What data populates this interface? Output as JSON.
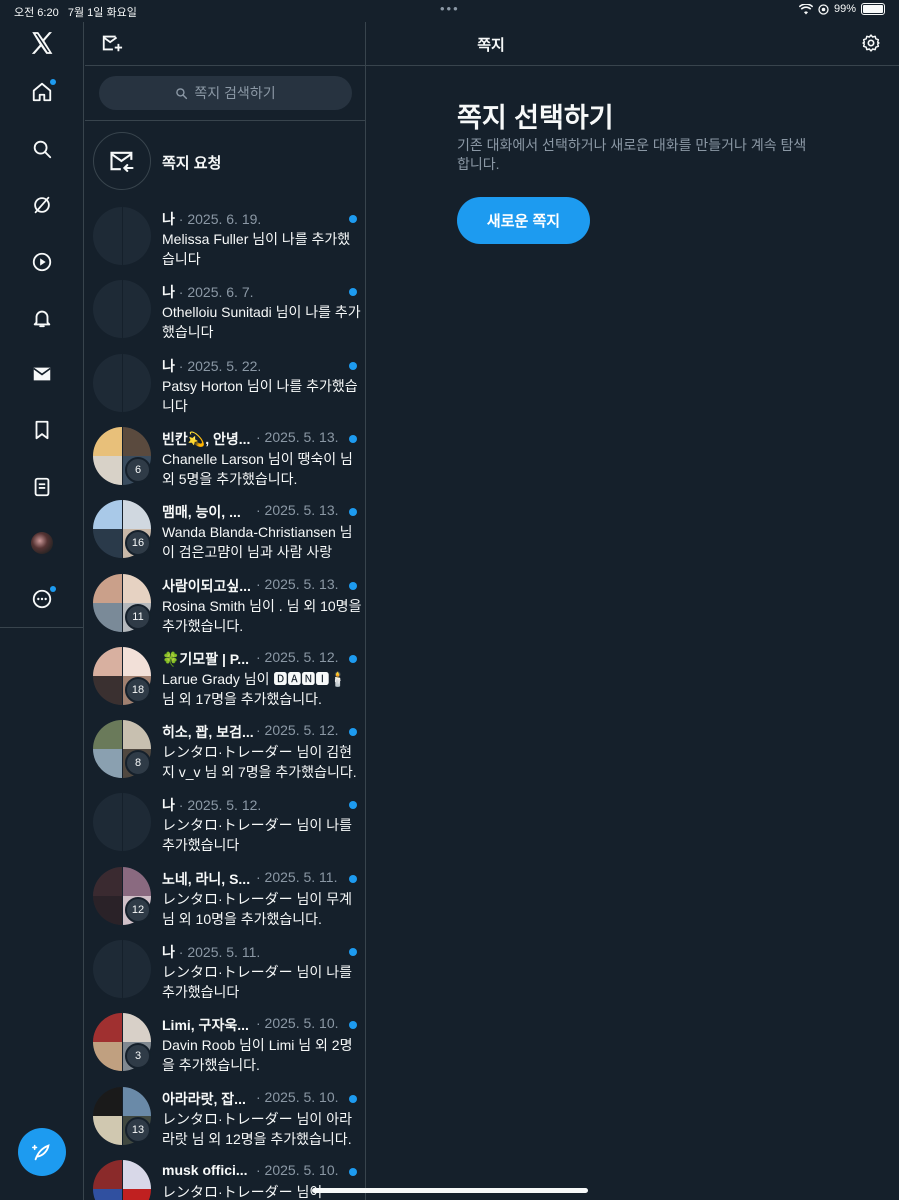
{
  "status_bar": {
    "time": "오전 6:20",
    "date": "7월 1일 화요일",
    "dots": "•••",
    "battery": "99%"
  },
  "nav": {
    "items": [
      {
        "name": "home",
        "icon": "home-icon",
        "dot": true
      },
      {
        "name": "explore",
        "icon": "search-icon",
        "dot": false
      },
      {
        "name": "grok",
        "icon": "grok-icon",
        "dot": false
      },
      {
        "name": "video",
        "icon": "play-icon",
        "dot": false
      },
      {
        "name": "notifications",
        "icon": "bell-icon",
        "dot": false
      },
      {
        "name": "messages",
        "icon": "envelope-icon",
        "dot": false
      },
      {
        "name": "bookmarks",
        "icon": "bookmark-icon",
        "dot": false
      },
      {
        "name": "lists",
        "icon": "list-icon",
        "dot": false
      },
      {
        "name": "profile",
        "icon": "avatar",
        "dot": false
      },
      {
        "name": "more",
        "icon": "more-icon",
        "dot": true
      }
    ]
  },
  "list": {
    "search_placeholder": "쪽지 검색하기",
    "requests_label": "쪽지 요청",
    "conversations": [
      {
        "name": "나",
        "date": "· 2025. 6. 19.",
        "body": "Melissa Fuller 님이 나를 추가했습니다",
        "count": "",
        "group": false
      },
      {
        "name": "나",
        "date": "· 2025. 6. 7.",
        "body": "Othelloiu Sunitadi 님이 나를 추가했습니다",
        "count": "",
        "group": false
      },
      {
        "name": "나",
        "date": "· 2025. 5. 22.",
        "body": "Patsy Horton 님이 나를 추가했습니다",
        "count": "",
        "group": false
      },
      {
        "name": "빈칸💫, 안녕...",
        "date": "· 2025. 5. 13.",
        "body": "Chanelle Larson 님이 땡숙이 님 외 5명을 추가했습니다.",
        "count": "6",
        "group": true
      },
      {
        "name": "맴매, 능이, ...",
        "date": "· 2025. 5. 13.",
        "body": "Wanda Blanda-Christiansen 님이 검은고먐이 님과 사람 사랑",
        "count": "16",
        "group": true
      },
      {
        "name": "사람이되고싶...",
        "date": "· 2025. 5. 13.",
        "body": "Rosina Smith 님이 . 님 외 10명을 추가했습니다.",
        "count": "11",
        "group": true
      },
      {
        "name": "🍀기모팔 | P...",
        "date": "· 2025. 5. 12.",
        "body": "Larue Grady 님이 🅳🅰🅽🅸🕯️ 님 외 17명을 추가했습니다.",
        "count": "18",
        "group": true
      },
      {
        "name": "히소, 꽙, 보검...",
        "date": "· 2025. 5. 12.",
        "body": "レンタロ·トレーダー 님이 김현지 v_v 님 외 7명을 추가했습니다.",
        "count": "8",
        "group": true
      },
      {
        "name": "나",
        "date": "· 2025. 5. 12.",
        "body": "レンタロ·トレーダー 님이 나를 추가했습니다",
        "count": "",
        "group": false
      },
      {
        "name": "노네, 라니, S...",
        "date": "· 2025. 5. 11.",
        "body": "レンタロ·トレーダー 님이 무계 님 외 10명을 추가했습니다.",
        "count": "12",
        "group": true
      },
      {
        "name": "나",
        "date": "· 2025. 5. 11.",
        "body": "レンタロ·トレーダー 님이 나를 추가했습니다",
        "count": "",
        "group": false
      },
      {
        "name": "Limi, 구자욱...",
        "date": "· 2025. 5. 10.",
        "body": "Davin Roob 님이 Limi 님 외 2명을 추가했습니다.",
        "count": "3",
        "group": true
      },
      {
        "name": "아라라랏, 잡...",
        "date": "· 2025. 5. 10.",
        "body": "レンタロ·トレーダー 님이 아라라랏 님 외 12명을 추가했습니다.",
        "count": "13",
        "group": true
      },
      {
        "name": "musk offici...",
        "date": "· 2025. 5. 10.",
        "body": "レンタロ·トレーダー 님이",
        "count": "",
        "group": true
      }
    ]
  },
  "main": {
    "header_title": "쪽지",
    "empty_title": "쪽지 선택하기",
    "empty_subtitle": "기존 대화에서 선택하거나 새로운 대화를 만들거나 계속 탐색합니다.",
    "new_message_button": "새로운 쪽지"
  },
  "colors": {
    "accent": "#1d9bf0",
    "background": "#15202b",
    "border": "#38444d",
    "muted": "#8b98a5"
  }
}
